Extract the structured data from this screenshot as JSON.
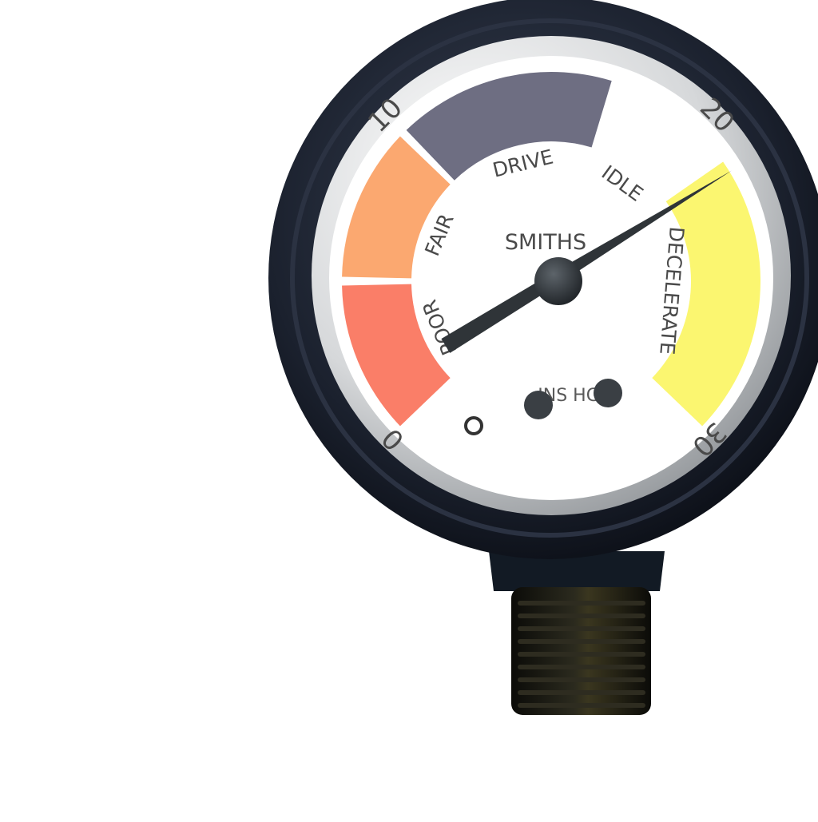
{
  "gauge": {
    "brand": "SMITHS",
    "units_text": "INS HG",
    "scale": {
      "min": 0,
      "max": 30,
      "reading": 21.5,
      "tick_labels": [
        "0",
        "10",
        "20",
        "30"
      ]
    },
    "zones": [
      {
        "label": "POOR",
        "from": 0,
        "to": 5,
        "color": "#fa7e68"
      },
      {
        "label": "FAIR",
        "from": 5,
        "to": 10,
        "color": "#fba870"
      },
      {
        "label": "DRIVE",
        "from": 10,
        "to": 17,
        "color": "#6e6e82"
      },
      {
        "label": "IDLE",
        "from": 17,
        "to": 21,
        "color": "#ffffff"
      },
      {
        "label": "DECELERATE",
        "from": 21,
        "to": 30,
        "color": "#fbf670"
      }
    ],
    "colors": {
      "bezel": "#161b26",
      "face": "#ffffff",
      "needle": "#2f3438",
      "text": "#4a4a4a",
      "fitting": "#1a1a14"
    }
  }
}
